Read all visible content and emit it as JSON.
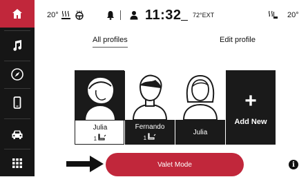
{
  "status": {
    "left_temp": "20°",
    "clock": "11:32",
    "ext_temp": "72°EXT",
    "right_temp": "20°"
  },
  "tabs": {
    "all_profiles": "All profiles",
    "edit_profile": "Edit profile"
  },
  "profiles": [
    {
      "name": "Julia",
      "seat": "1",
      "selected": true
    },
    {
      "name": "Fernando",
      "seat": "1",
      "selected": false
    },
    {
      "name": "Julia",
      "seat": "",
      "selected": false
    }
  ],
  "add_new": {
    "symbol": "+",
    "label": "Add New"
  },
  "valet_button": "Valet Mode",
  "info_symbol": "i",
  "colors": {
    "accent": "#c1273b",
    "sidebar": "#161616",
    "card": "#1a1a1a"
  },
  "nav": [
    "home-icon",
    "music-note-icon",
    "compass-icon",
    "phone-icon",
    "car-icon",
    "apps-grid-icon"
  ]
}
